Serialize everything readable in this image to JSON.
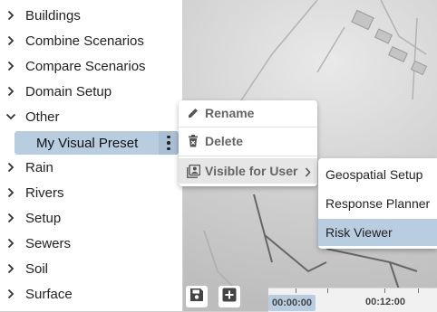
{
  "sidebar": {
    "items": [
      {
        "label": "Buildings",
        "expanded": false
      },
      {
        "label": "Combine Scenarios",
        "expanded": false
      },
      {
        "label": "Compare Scenarios",
        "expanded": false
      },
      {
        "label": "Domain Setup",
        "expanded": false
      },
      {
        "label": "Other",
        "expanded": true
      },
      {
        "label": "Rain",
        "expanded": false
      },
      {
        "label": "Rivers",
        "expanded": false
      },
      {
        "label": "Setup",
        "expanded": false
      },
      {
        "label": "Sewers",
        "expanded": false
      },
      {
        "label": "Soil",
        "expanded": false
      },
      {
        "label": "Surface",
        "expanded": false
      }
    ],
    "selected_child": {
      "label": "My Visual Preset",
      "parent": "Other"
    }
  },
  "context_menu": {
    "items": [
      {
        "label": "Rename",
        "icon": "pencil-icon"
      },
      {
        "label": "Delete",
        "icon": "trash-icon"
      },
      {
        "label": "Visible for User",
        "icon": "user-visibility-icon",
        "has_submenu": true
      }
    ]
  },
  "submenu": {
    "items": [
      {
        "label": "Geospatial Setup",
        "selected": false
      },
      {
        "label": "Response Planner",
        "selected": false
      },
      {
        "label": "Risk Viewer",
        "selected": true
      }
    ]
  },
  "toolbar": {
    "save_icon": "save-icon",
    "add_icon": "add-icon"
  },
  "timeline": {
    "current": "00:00:00",
    "tick_label": "00:12:00"
  },
  "colors": {
    "selection": "#b9cde0",
    "menu_text": "#666666",
    "map_shade": "#cfcfcf"
  }
}
